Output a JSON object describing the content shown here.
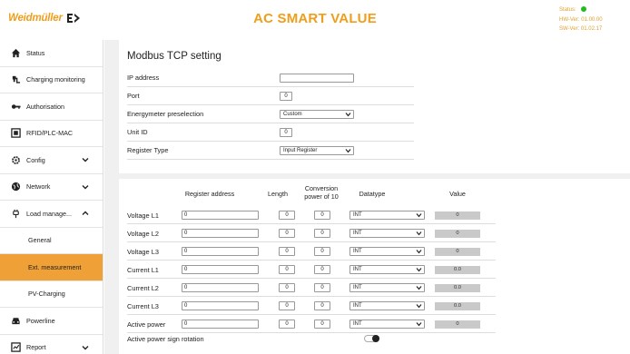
{
  "header": {
    "logo_text": "Weidmüller",
    "title": "AC SMART VALUE",
    "status_label": "Status:",
    "hw_version": "HW-Ver: 01.00.00",
    "sw_version": "SW-Ver: 01.02.17",
    "status_color": "#22bb22",
    "brand_color": "#ef9e1b"
  },
  "sidebar": {
    "items": [
      {
        "label": "Status",
        "icon": "home-icon"
      },
      {
        "label": "Charging monitoring",
        "icon": "charging-plug-icon"
      },
      {
        "label": "Authorisation",
        "icon": "key-icon"
      },
      {
        "label": "RFID/PLC-MAC",
        "icon": "rfid-card-icon"
      },
      {
        "label": "Config",
        "icon": "gear-icon"
      },
      {
        "label": "Network",
        "icon": "globe-icon"
      },
      {
        "label": "Load manage...",
        "icon": "plug-icon"
      }
    ],
    "sub_items": [
      {
        "label": "General"
      },
      {
        "label": "Ext. measurement",
        "active": true
      },
      {
        "label": "PV-Charging"
      }
    ],
    "bottom_items": [
      {
        "label": "Powerline",
        "icon": "car-icon"
      },
      {
        "label": "Report",
        "icon": "report-icon"
      }
    ],
    "active_color": "#efa036"
  },
  "modbus": {
    "title": "Modbus TCP setting",
    "ip_label": "IP address",
    "ip_value": "",
    "port_label": "Port",
    "port_value": "0",
    "energymeter_label": "Energymeter preselection",
    "energymeter_value": "Custom",
    "unit_id_label": "Unit ID",
    "unit_id_value": "0",
    "register_type_label": "Register Type",
    "register_type_value": "Input Register"
  },
  "table": {
    "headers": {
      "address": "Register address",
      "length": "Length",
      "power_line1": "Conversion",
      "power_line2": "power of 10",
      "datatype": "Datatype",
      "value": "Value"
    },
    "rows": [
      {
        "label": "Voltage L1",
        "address": "0",
        "length": "0",
        "power": "0",
        "datatype": "INT",
        "value": "0"
      },
      {
        "label": "Voltage L2",
        "address": "0",
        "length": "0",
        "power": "0",
        "datatype": "INT",
        "value": "0"
      },
      {
        "label": "Voltage L3",
        "address": "0",
        "length": "0",
        "power": "0",
        "datatype": "INT",
        "value": "0"
      },
      {
        "label": "Current L1",
        "address": "0",
        "length": "0",
        "power": "0",
        "datatype": "INT",
        "value": "0.0"
      },
      {
        "label": "Current L2",
        "address": "0",
        "length": "0",
        "power": "0",
        "datatype": "INT",
        "value": "0.0"
      },
      {
        "label": "Current L3",
        "address": "0",
        "length": "0",
        "power": "0",
        "datatype": "INT",
        "value": "0.0"
      },
      {
        "label": "Active power",
        "address": "0",
        "length": "0",
        "power": "0",
        "datatype": "INT",
        "value": "0"
      }
    ],
    "sign_rotation_label": "Active power sign rotation",
    "sign_rotation_on": true
  }
}
